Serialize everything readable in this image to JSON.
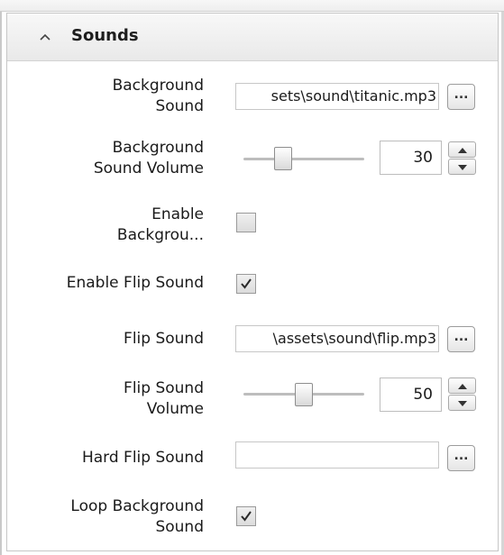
{
  "section": {
    "title": "Sounds",
    "expanded": true
  },
  "properties": {
    "background_sound": {
      "label_line1": "Background",
      "label_line2": "Sound",
      "value": "sets\\sound\\titanic.mp3",
      "browse_label": "..."
    },
    "background_sound_volume": {
      "label_line1": "Background",
      "label_line2": "Sound Volume",
      "value": "30",
      "slider_fraction": 0.3
    },
    "enable_background": {
      "label_line1": "Enable",
      "label_line2": "Backgrou...",
      "checked": false
    },
    "enable_flip_sound": {
      "label": "Enable Flip Sound",
      "checked": true
    },
    "flip_sound": {
      "label": "Flip Sound",
      "value": "\\assets\\sound\\flip.mp3",
      "browse_label": "..."
    },
    "flip_sound_volume": {
      "label_line1": "Flip Sound",
      "label_line2": "Volume",
      "value": "50",
      "slider_fraction": 0.5
    },
    "hard_flip_sound": {
      "label": "Hard Flip Sound",
      "value": "",
      "browse_label": "..."
    },
    "loop_background_sound": {
      "label_line1": "Loop Background",
      "label_line2": "Sound",
      "checked": true
    }
  },
  "colors": {
    "header_bg": "#eeeeee",
    "border": "#c6c6c6",
    "check": "#2a2a2a"
  }
}
